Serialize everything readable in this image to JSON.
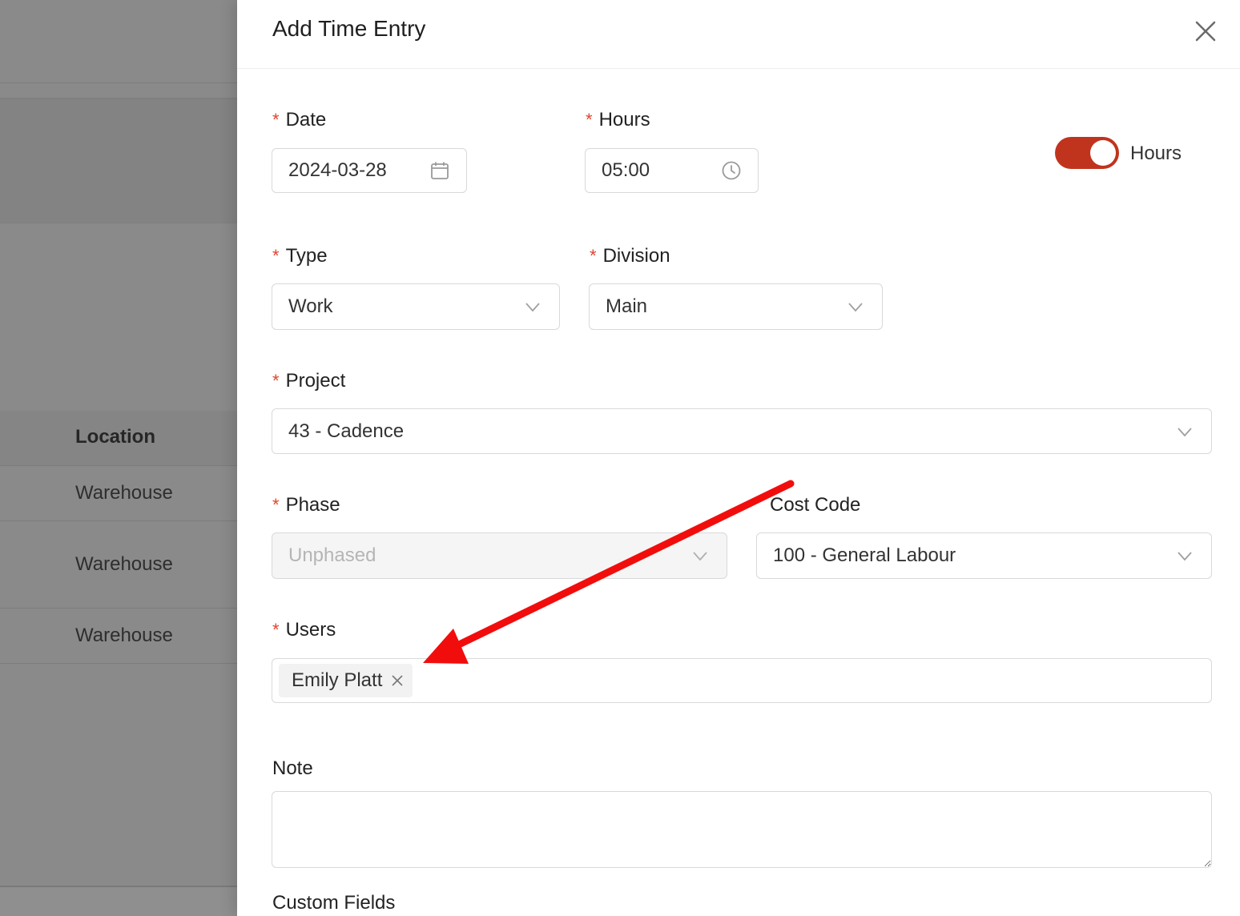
{
  "background": {
    "column_header": "Location",
    "rows": [
      "Warehouse",
      "Warehouse",
      "Warehouse"
    ]
  },
  "drawer": {
    "title": "Add Time Entry",
    "close_icon": "close-icon"
  },
  "form": {
    "date": {
      "label": "Date",
      "value": "2024-03-28",
      "icon": "calendar-icon"
    },
    "hours": {
      "label": "Hours",
      "value": "05:00",
      "icon": "clock-icon"
    },
    "mode_toggle": {
      "label": "Hours",
      "on": true,
      "color": "#c0341d"
    },
    "type": {
      "label": "Type",
      "value": "Work"
    },
    "division": {
      "label": "Division",
      "value": "Main"
    },
    "project": {
      "label": "Project",
      "value": "43 - Cadence"
    },
    "phase": {
      "label": "Phase",
      "value": "Unphased",
      "disabled": true
    },
    "cost_code": {
      "label": "Cost Code",
      "value": "100 - General Labour"
    },
    "users": {
      "label": "Users",
      "selected": [
        "Emily Platt"
      ]
    },
    "note": {
      "label": "Note",
      "value": ""
    },
    "custom_fields": {
      "label": "Custom Fields"
    }
  },
  "annotation": {
    "arrow_color": "#ff0000"
  }
}
